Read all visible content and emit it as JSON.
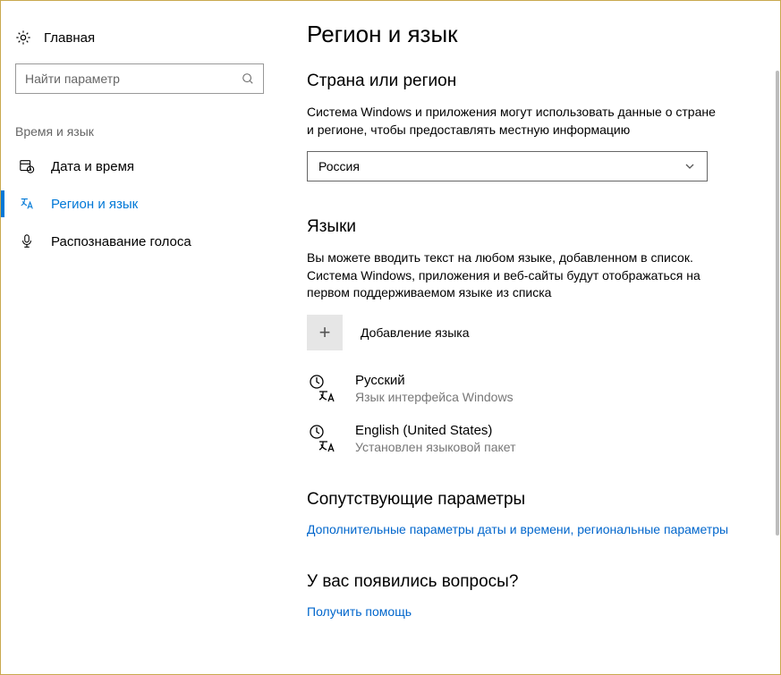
{
  "sidebar": {
    "home": "Главная",
    "search_placeholder": "Найти параметр",
    "section_label": "Время и язык",
    "items": [
      {
        "label": "Дата и время"
      },
      {
        "label": "Регион и язык"
      },
      {
        "label": "Распознавание голоса"
      }
    ]
  },
  "main": {
    "title": "Регион и язык",
    "country_section": {
      "heading": "Страна или регион",
      "description": "Система Windows и приложения могут использовать данные о стране и регионе, чтобы предоставлять местную информацию",
      "selected": "Россия"
    },
    "languages_section": {
      "heading": "Языки",
      "description": "Вы можете вводить текст на любом языке, добавленном в список. Система Windows, приложения и веб-сайты будут отображаться на первом поддерживаемом языке из списка",
      "add_label": "Добавление языка",
      "items": [
        {
          "name": "Русский",
          "subtitle": "Язык интерфейса Windows"
        },
        {
          "name": "English (United States)",
          "subtitle": "Установлен языковой пакет"
        }
      ]
    },
    "related_section": {
      "heading": "Сопутствующие параметры",
      "link": "Дополнительные параметры даты и времени, региональные параметры"
    },
    "help_section": {
      "heading": "У вас появились вопросы?",
      "link": "Получить помощь"
    }
  }
}
